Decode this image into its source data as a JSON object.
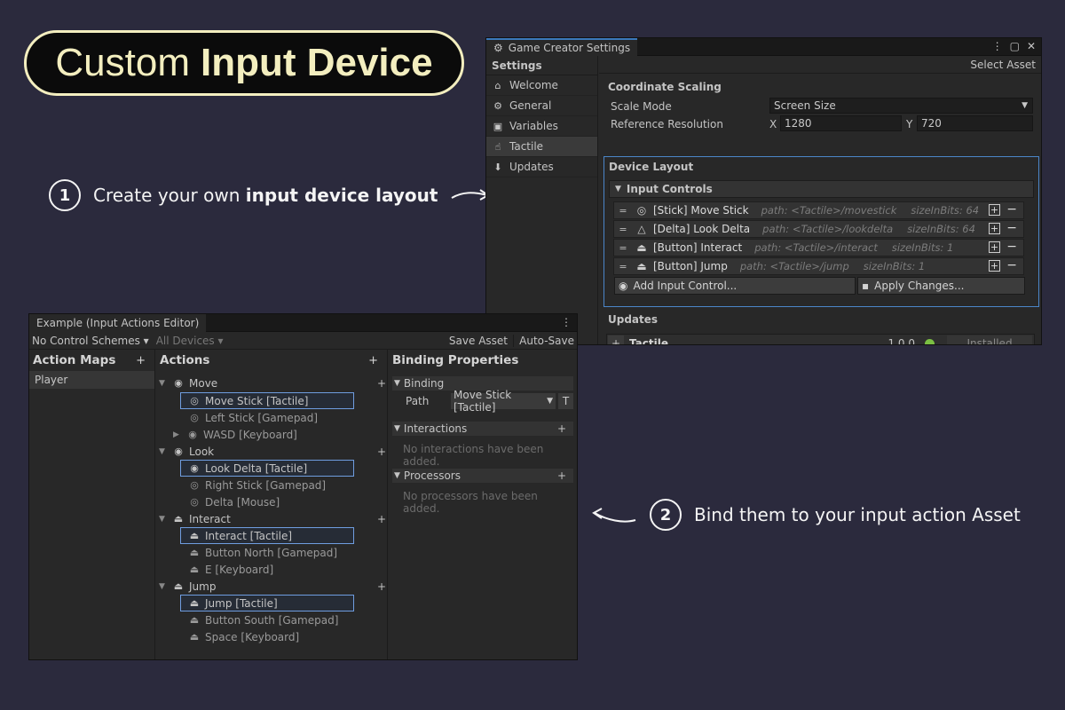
{
  "hero": {
    "title_plain": "Custom",
    "title_bold": "Input Device"
  },
  "callouts": [
    {
      "number": "1",
      "text_before": "Create your own ",
      "text_bold": "input device layout",
      "text_after": ""
    },
    {
      "number": "2",
      "text_before": "Bind them to your input action Asset",
      "text_bold": "",
      "text_after": ""
    }
  ],
  "settings_window": {
    "tab_title": "Game Creator Settings",
    "sidebar_title": "Settings",
    "select_asset": "Select Asset",
    "sidebar_items": [
      {
        "label": "Welcome",
        "icon": "home-icon"
      },
      {
        "label": "General",
        "icon": "gear-icon"
      },
      {
        "label": "Variables",
        "icon": "variables-icon"
      },
      {
        "label": "Tactile",
        "icon": "tactile-icon"
      },
      {
        "label": "Updates",
        "icon": "download-icon"
      }
    ],
    "coordinate_scaling": {
      "heading": "Coordinate Scaling",
      "scale_mode_label": "Scale Mode",
      "scale_mode_value": "Screen Size",
      "ref_res_label": "Reference Resolution",
      "x_label": "X",
      "x_value": "1280",
      "y_label": "Y",
      "y_value": "720"
    },
    "device_layout": {
      "heading": "Device Layout",
      "input_controls_heading": "Input Controls",
      "controls": [
        {
          "icon": "stick-icon",
          "name": "[Stick] Move Stick",
          "path": "path: <Tactile>/movestick",
          "bits": "sizeInBits: 64"
        },
        {
          "icon": "delta-icon",
          "name": "[Delta] Look Delta",
          "path": "path: <Tactile>/lookdelta",
          "bits": "sizeInBits: 64"
        },
        {
          "icon": "button-icon",
          "name": "[Button] Interact",
          "path": "path: <Tactile>/interact",
          "bits": "sizeInBits: 1"
        },
        {
          "icon": "button-icon",
          "name": "[Button] Jump",
          "path": "path: <Tactile>/jump",
          "bits": "sizeInBits: 1"
        }
      ],
      "add_control": "Add Input Control...",
      "apply_changes": "Apply Changes..."
    },
    "updates": {
      "heading": "Updates",
      "package": "Tactile",
      "version": "1.0.0",
      "status": "Installed"
    }
  },
  "editor_window": {
    "tab_title": "Example (Input Actions Editor)",
    "control_schemes": "No Control Schemes",
    "all_devices": "All Devices",
    "save_asset": "Save Asset",
    "auto_save": "Auto-Save",
    "action_maps_heading": "Action Maps",
    "action_maps": [
      "Player"
    ],
    "actions_heading": "Actions",
    "actions": [
      {
        "name": "Move",
        "bindings": [
          "Move Stick [Tactile]",
          "Left Stick [Gamepad]",
          "WASD [Keyboard]"
        ]
      },
      {
        "name": "Look",
        "bindings": [
          "Look Delta [Tactile]",
          "Right Stick [Gamepad]",
          "Delta [Mouse]"
        ]
      },
      {
        "name": "Interact",
        "bindings": [
          "Interact [Tactile]",
          "Button North [Gamepad]",
          "E [Keyboard]"
        ]
      },
      {
        "name": "Jump",
        "bindings": [
          "Jump [Tactile]",
          "Button South [Gamepad]",
          "Space [Keyboard]"
        ]
      }
    ],
    "binding_properties": {
      "heading": "Binding Properties",
      "binding_label": "Binding",
      "path_label": "Path",
      "path_value": "Move Stick [Tactile]",
      "t_button": "T",
      "interactions_label": "Interactions",
      "interactions_empty": "No interactions have been added.",
      "processors_label": "Processors",
      "processors_empty": "No processors have been added."
    }
  },
  "colors": {
    "background": "#2b2a3d",
    "accent_cream": "#f3eebf",
    "selection_blue": "#6f9de0",
    "installed_green": "#7bc043"
  }
}
